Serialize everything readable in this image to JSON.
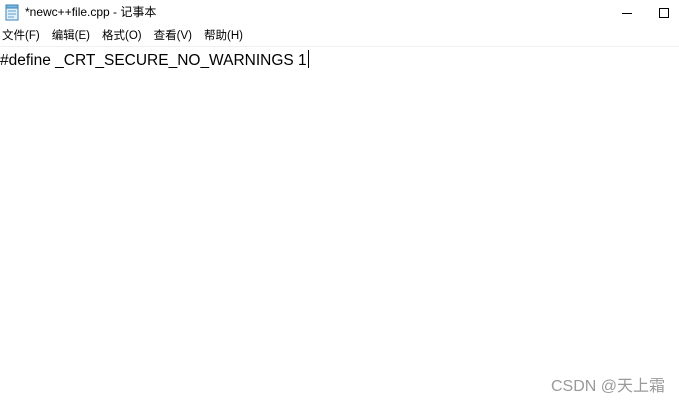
{
  "window": {
    "title": "*newc++file.cpp - 记事本",
    "icon": "notepad-icon",
    "controls": {
      "minimize_icon": "minimize-icon",
      "maximize_icon": "maximize-icon"
    }
  },
  "menu": {
    "items": [
      {
        "label": "文件(F)"
      },
      {
        "label": "编辑(E)"
      },
      {
        "label": "格式(O)"
      },
      {
        "label": "查看(V)"
      },
      {
        "label": "帮助(H)"
      }
    ]
  },
  "editor": {
    "lines": [
      "#define _CRT_SECURE_NO_WARNINGS 1"
    ]
  },
  "watermark": {
    "text": "CSDN @天上霜"
  }
}
